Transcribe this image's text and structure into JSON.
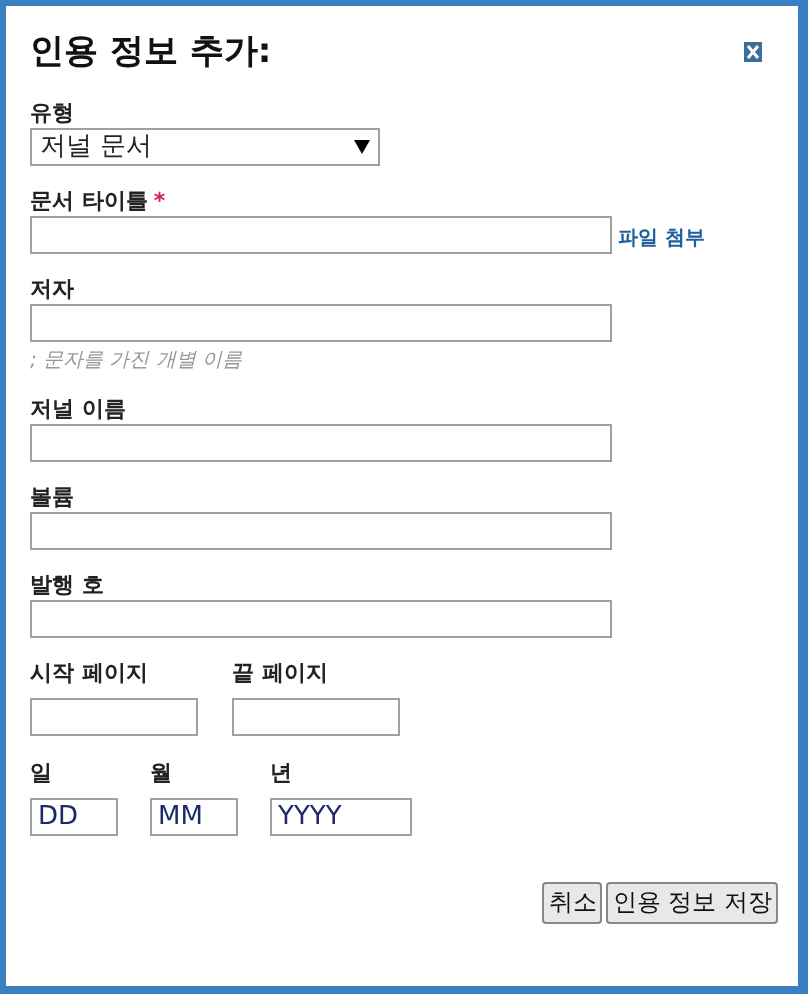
{
  "dialog": {
    "title": "인용 정보 추가:"
  },
  "fields": [
    {
      "kind": "select",
      "label": "유형",
      "value": "저널 문서"
    },
    {
      "kind": "text",
      "label": "문서 타이틀",
      "required_mark": "*",
      "link": "파일 첨부"
    },
    {
      "kind": "text",
      "label": "저자",
      "help": "; 문자를 가진 개별 이름"
    },
    {
      "kind": "text",
      "label": "저널 이름"
    },
    {
      "kind": "text",
      "label": "볼륨"
    },
    {
      "kind": "text",
      "label": "발행 호"
    }
  ],
  "page_fields": [
    {
      "label": "시작 페이지"
    },
    {
      "label": "끝 페이지"
    }
  ],
  "date_fields": [
    {
      "label": "일",
      "value": "DD"
    },
    {
      "label": "월",
      "value": "MM"
    },
    {
      "label": "년",
      "value": "YYYY"
    }
  ],
  "buttons": [
    "취소",
    "인용 정보 저장"
  ]
}
